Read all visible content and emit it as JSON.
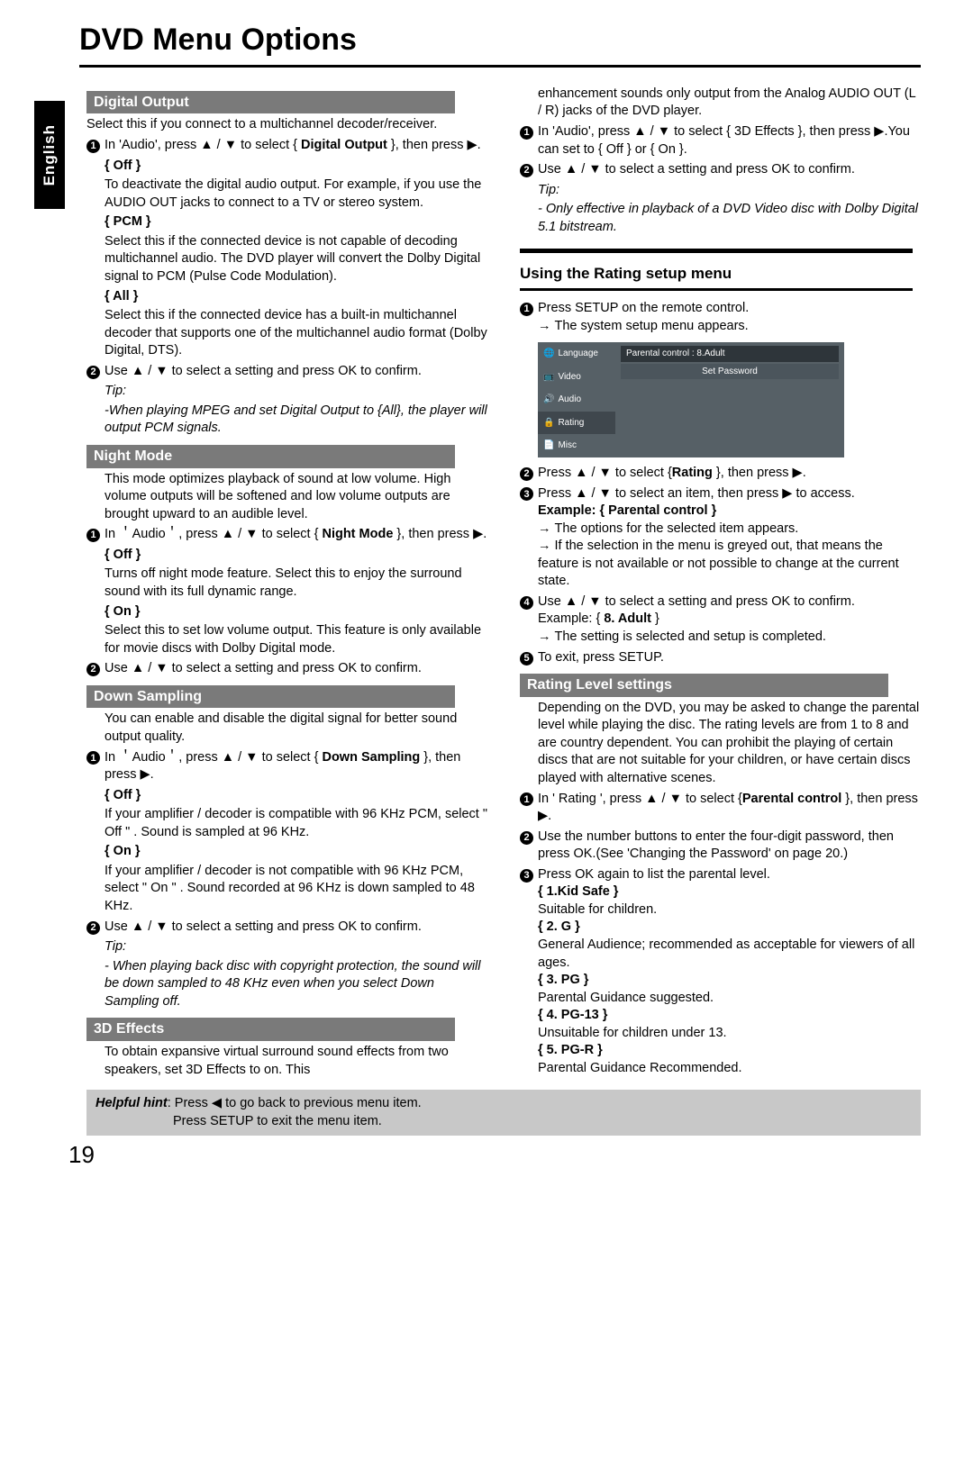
{
  "page_title": "DVD Menu Options",
  "lang_tab": "English",
  "page_number": "19",
  "symbols": {
    "up": "▲",
    "down": "▼",
    "play": "▶",
    "back": "◀"
  },
  "hint": {
    "label": "Helpful hint",
    "line1": ": Press ◀ to go back to previous menu item.",
    "line2": "Press SETUP to exit the menu item."
  },
  "left": {
    "digital_output": {
      "title": "Digital Output",
      "intro": "Select this if you connect to a multichannel decoder/receiver.",
      "step1_a": "In 'Audio', press ▲ / ▼ to select { ",
      "step1_b": "Digital Output",
      "step1_c": " }, then press ▶.",
      "off_label": "{ Off }",
      "off_text": "To deactivate the digital audio output. For example, if you use the AUDIO OUT jacks to connect to a TV or stereo system.",
      "pcm_label": "{ PCM }",
      "pcm_text": "Select this if the connected device is not capable of decoding multichannel audio. The DVD player will convert the Dolby Digital signal to PCM (Pulse Code Modulation).",
      "all_label": "{ All }",
      "all_text": "Select this if the connected device has a built-in multichannel decoder that supports one of the multichannel audio format (Dolby Digital, DTS).",
      "step2": "Use ▲ / ▼ to select a setting  and press OK to confirm.",
      "tip_label": "Tip:",
      "tip_text": "-When playing MPEG and set Digital Output to {All}, the player will output PCM signals."
    },
    "night_mode": {
      "title": "Night Mode",
      "intro": "This mode optimizes playback of sound at low volume. High volume outputs will be softened and low volume outputs are brought upward to an audible level.",
      "step1_a": "In ＇Audio＇, press ▲ / ▼ to select { ",
      "step1_b": "Night Mode",
      "step1_c": " }, then press ▶.",
      "off_label": "{ Off }",
      "off_text": "Turns off night mode feature. Select this to enjoy the surround sound with its full dynamic range.",
      "on_label": "{ On }",
      "on_text": "Select this to set low volume output. This feature is only available for movie discs with Dolby Digital mode.",
      "step2": "Use ▲ / ▼ to select a setting and press OK to confirm."
    },
    "down_sampling": {
      "title": "Down Sampling",
      "intro": "You can enable and disable the digital signal for better sound output quality.",
      "step1_a": "In ＇Audio＇, press ▲ / ▼ to select { ",
      "step1_b": "Down Sampling",
      "step1_c": " }, then press ▶.",
      "off_label": "{ Off }",
      "off_text": "If your amplifier / decoder is compatible with 96 KHz PCM, select \" Off \" . Sound is sampled at 96 KHz.",
      "on_label": "{ On }",
      "on_text": "If your amplifier / decoder is not compatible with 96 KHz PCM, select \" On \" . Sound recorded at 96 KHz is down sampled to 48 KHz.",
      "step2": "Use ▲ / ▼ to select a setting and press OK to confirm.",
      "tip_label": "Tip:",
      "tip_text": "- When playing back disc with copyright protection, the sound will be down sampled to 48 KHz even when you select Down Sampling off."
    },
    "effects_3d": {
      "title": "3D Effects",
      "intro": "To obtain expansive virtual surround sound effects from two speakers, set 3D Effects to on. This"
    }
  },
  "right": {
    "effects_cont": {
      "line": "enhancement sounds only output from the Analog AUDIO OUT (L / R) jacks of the DVD player.",
      "step1": "In 'Audio', press ▲ / ▼ to select { 3D Effects }, then press ▶.You can set to { Off } or { On }.",
      "step2": "Use ▲ / ▼ to select a setting and press OK to confirm.",
      "tip_label": "Tip:",
      "tip_text": "- Only effective in playback of a DVD Video disc with Dolby Digital 5.1 bitstream."
    },
    "rating_menu": {
      "title": "Using the Rating setup menu",
      "step1a": "Press SETUP on the remote control.",
      "step1b": "The system setup menu appears.",
      "osd": {
        "side": [
          "Language",
          "Video",
          "Audio",
          "Rating",
          "Misc"
        ],
        "row1": "Parental  control        : 8.Adult",
        "row2": "Set Password"
      },
      "step2_a": "Press ▲ / ▼ to select {",
      "step2_b": "Rating",
      "step2_c": " }, then press ▶.",
      "step3": "Press ▲ / ▼ to select an item, then press ▶ to access.",
      "example_label": "Example: { Parental control }",
      "ex_a": "The options for the selected item appears.",
      "ex_b": "If the selection in the menu is greyed out, that means the feature is not available or not possible to change at the current state.",
      "step4a": "Use ▲ / ▼ to select a setting and press OK to confirm.",
      "step4b_label": "Example: { ",
      "step4b_val": "8. Adult",
      "step4b_end": " }",
      "step4c": "The setting is selected and setup is completed.",
      "step5": "To exit, press SETUP."
    },
    "rating_level": {
      "title": "Rating Level settings",
      "intro": "Depending on the DVD, you may be asked to change the parental level while playing the disc. The rating levels are from 1 to 8 and are country dependent. You can prohibit the playing of certain discs that are not suitable for your children, or have certain discs played with alternative scenes.",
      "step1_a": "In ' Rating ', press ▲ / ▼ to select {",
      "step1_b": "Parental control",
      "step1_c": " }, then press ▶.",
      "step2": "Use the number buttons to enter the four-digit password, then press OK.(See 'Changing the Password' on page 20.)",
      "step3": "Press OK again to list the parental level.",
      "l1_label": "{ 1.Kid Safe }",
      "l1_text": "Suitable for children.",
      "l2_label": "{ 2. G }",
      "l2_text": "General Audience; recommended as acceptable for viewers of all ages.",
      "l3_label": "{ 3. PG }",
      "l3_text": "Parental Guidance suggested.",
      "l4_label": "{ 4. PG-13 }",
      "l4_text": "Unsuitable for children under 13.",
      "l5_label": "{ 5. PG-R }",
      "l5_text": "Parental Guidance Recommended."
    }
  }
}
